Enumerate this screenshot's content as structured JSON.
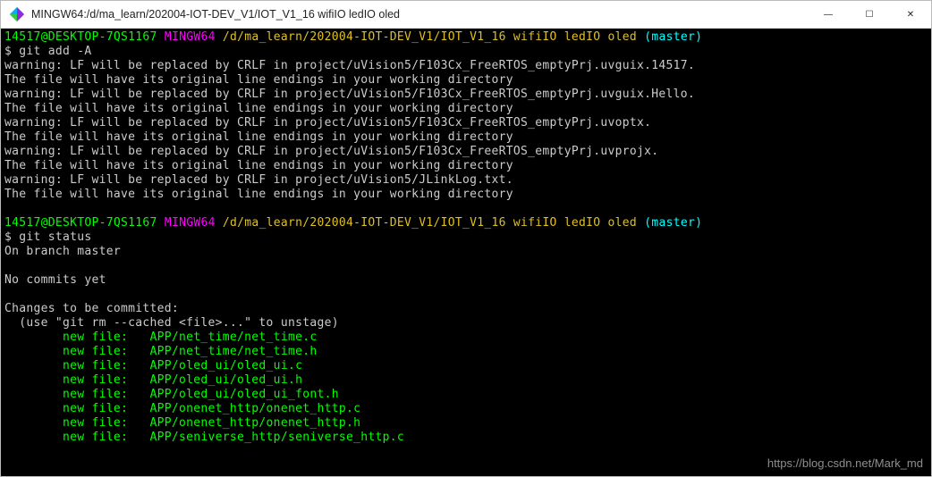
{
  "window": {
    "title": "MINGW64:/d/ma_learn/202004-IOT-DEV_V1/IOT_V1_16 wifiIO ledIO oled"
  },
  "prompt1": {
    "user_host": "14517@DESKTOP-7QS1167",
    "shell": "MINGW64",
    "path": "/d/ma_learn/202004-IOT-DEV_V1/IOT_V1_16 wifiIO ledIO oled",
    "branch": "(master)",
    "dollar": "$ ",
    "command": "git add -A"
  },
  "warnings": [
    "warning: LF will be replaced by CRLF in project/uVision5/F103Cx_FreeRTOS_emptyPrj.uvguix.14517.",
    "The file will have its original line endings in your working directory",
    "warning: LF will be replaced by CRLF in project/uVision5/F103Cx_FreeRTOS_emptyPrj.uvguix.Hello.",
    "The file will have its original line endings in your working directory",
    "warning: LF will be replaced by CRLF in project/uVision5/F103Cx_FreeRTOS_emptyPrj.uvoptx.",
    "The file will have its original line endings in your working directory",
    "warning: LF will be replaced by CRLF in project/uVision5/F103Cx_FreeRTOS_emptyPrj.uvprojx.",
    "The file will have its original line endings in your working directory",
    "warning: LF will be replaced by CRLF in project/uVision5/JLinkLog.txt.",
    "The file will have its original line endings in your working directory"
  ],
  "prompt2": {
    "user_host": "14517@DESKTOP-7QS1167",
    "shell": "MINGW64",
    "path": "/d/ma_learn/202004-IOT-DEV_V1/IOT_V1_16 wifiIO ledIO oled",
    "branch": "(master)",
    "dollar": "$ ",
    "command": "git status"
  },
  "status_lines": [
    "On branch master",
    "",
    "No commits yet",
    "",
    "Changes to be committed:",
    "  (use \"git rm --cached <file>...\" to unstage)"
  ],
  "new_files": [
    "        new file:   APP/net_time/net_time.c",
    "        new file:   APP/net_time/net_time.h",
    "        new file:   APP/oled_ui/oled_ui.c",
    "        new file:   APP/oled_ui/oled_ui.h",
    "        new file:   APP/oled_ui/oled_ui_font.h",
    "        new file:   APP/onenet_http/onenet_http.c",
    "        new file:   APP/onenet_http/onenet_http.h",
    "        new file:   APP/seniverse_http/seniverse_http.c"
  ],
  "watermark": "https://blog.csdn.net/Mark_md"
}
